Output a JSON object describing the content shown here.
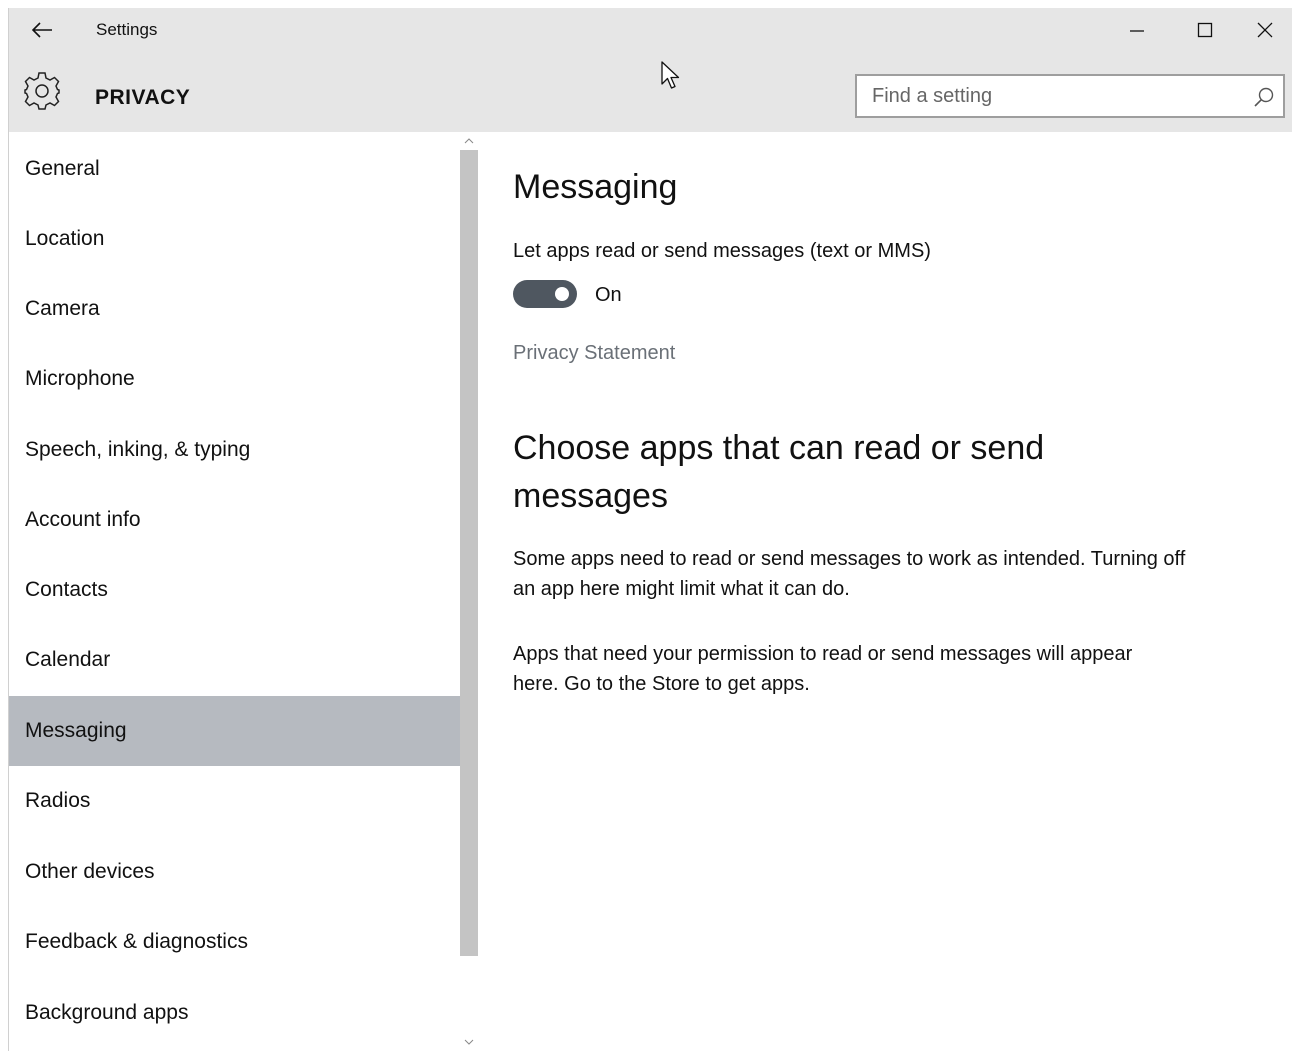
{
  "window": {
    "title": "Settings",
    "controls": [
      "minimize",
      "maximize",
      "close"
    ]
  },
  "header": {
    "section": "PRIVACY",
    "icon": "gear-icon",
    "search_placeholder": "Find a setting"
  },
  "sidebar": {
    "items": [
      {
        "label": "General"
      },
      {
        "label": "Location"
      },
      {
        "label": "Camera"
      },
      {
        "label": "Microphone"
      },
      {
        "label": "Speech, inking, & typing"
      },
      {
        "label": "Account info"
      },
      {
        "label": "Contacts"
      },
      {
        "label": "Calendar"
      },
      {
        "label": "Messaging",
        "selected": true
      },
      {
        "label": "Radios"
      },
      {
        "label": "Other devices"
      },
      {
        "label": "Feedback & diagnostics"
      },
      {
        "label": "Background apps"
      }
    ]
  },
  "main": {
    "title": "Messaging",
    "toggle": {
      "label": "Let apps read or send messages (text or MMS)",
      "state": "On",
      "on": true
    },
    "privacy_link": "Privacy Statement",
    "apps_heading": "Choose apps that can read or send messages",
    "description": "Some apps need to read or send messages to work as intended. Turning off an app here might limit what it can do.",
    "empty_text": "Apps that need your permission to read or send messages will appear here. Go to the Store to get apps."
  },
  "colors": {
    "titlebar_bg": "#e6e6e6",
    "selected_item_bg": "#b6bac0",
    "toggle_on_bg": "#4f5760",
    "link_color": "#6a7077"
  }
}
